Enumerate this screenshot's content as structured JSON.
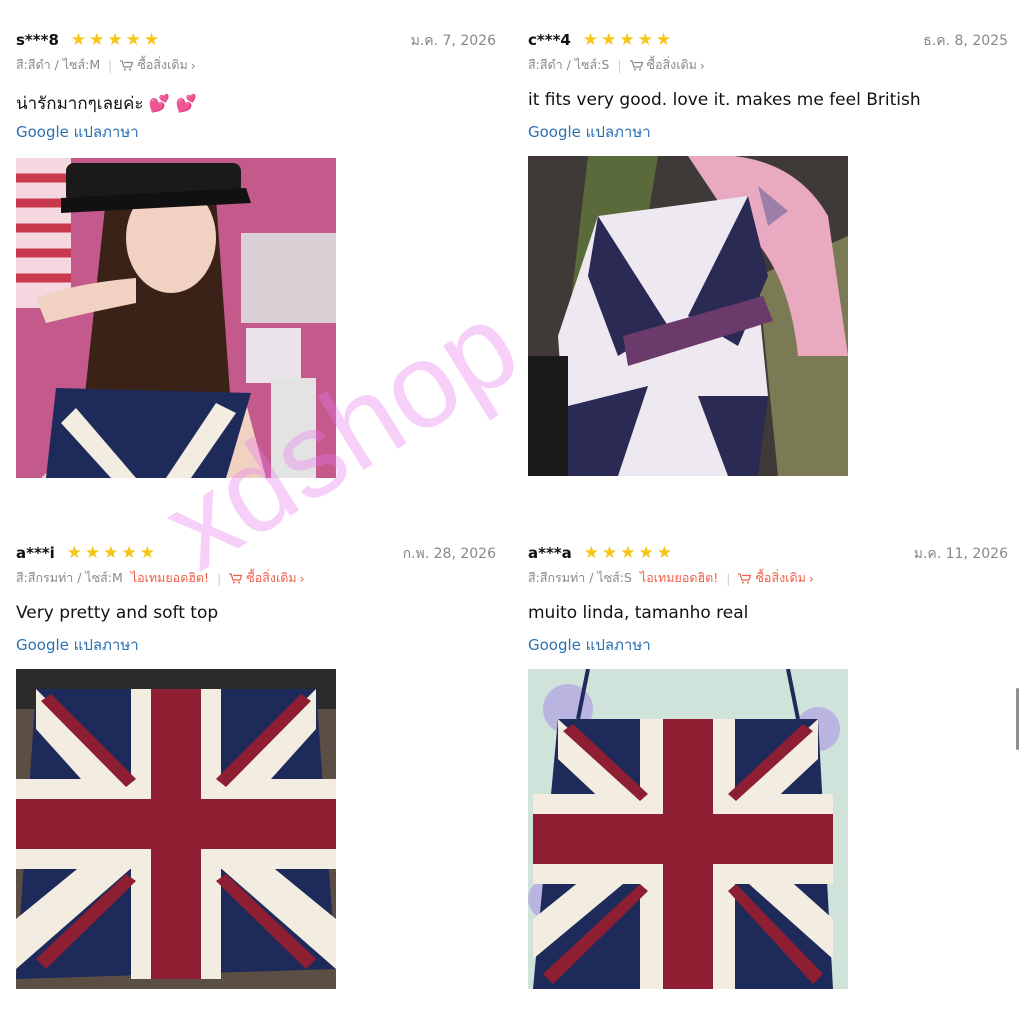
{
  "reviews": [
    {
      "user": "s***8",
      "date": "ม.ค. 7, 2026",
      "variant": "สี:สีดำ / ไซส์:M",
      "hot_label": "",
      "buy_label": "ซื้อสิ่งเดิม",
      "comment": "น่ารักมากๆเลยค่ะ",
      "translate": "Google แปลภาษา",
      "photo_icon": "woman-in-union-jack-top-photo"
    },
    {
      "user": "c***4",
      "date": "ธ.ค. 8, 2025",
      "variant": "สี:สีดำ / ไซส์:S",
      "hot_label": "",
      "buy_label": "ซื้อสิ่งเดิม",
      "comment": "it fits very good. love it. makes me feel British",
      "translate": "Google แปลภาษา",
      "photo_icon": "union-jack-top-selfie-photo"
    },
    {
      "user": "a***i",
      "date": "ก.พ. 28, 2026",
      "variant": "สี:สีกรมท่า / ไซส์:M",
      "hot_label": "ไอเทมยอดฮิต!",
      "buy_label": "ซื้อสิ่งเดิม",
      "comment": "Very pretty and soft top",
      "translate": "Google แปลภาษา",
      "photo_icon": "union-jack-top-product-photo"
    },
    {
      "user": "a***a",
      "date": "ม.ค. 11, 2026",
      "variant": "สี:สีกรมท่า / ไซส์:S",
      "hot_label": "ไอเทมยอดฮิต!",
      "buy_label": "ซื้อสิ่งเดิม",
      "comment": "muito linda, tamanho real",
      "translate": "Google แปลภาษา",
      "photo_icon": "union-jack-top-flatlay-photo"
    }
  ],
  "rating_stars": 5,
  "watermark": "xdshop",
  "colors": {
    "star": "#f5c518",
    "accent": "#f0604b",
    "link": "#2a6fb0",
    "navy": "#1e2a5a",
    "red": "#8e1f33"
  }
}
